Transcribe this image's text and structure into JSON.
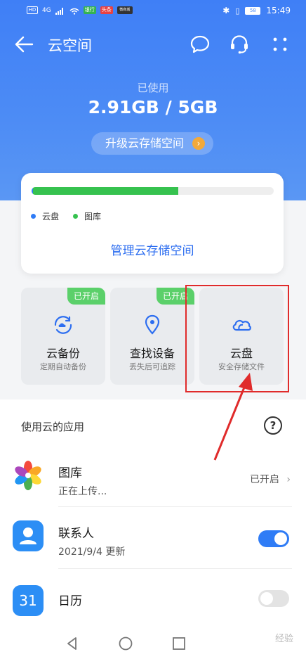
{
  "status_bar": {
    "time": "15:49",
    "battery": "58",
    "left_badges": [
      "HD",
      "4G",
      "银行",
      "头条",
      "微商城"
    ]
  },
  "header": {
    "title": "云空间",
    "back_icon": "back-arrow-icon",
    "actions": [
      "chat-bubble-icon",
      "headset-service-icon",
      "more-dots-icon"
    ]
  },
  "storage": {
    "used_label": "已使用",
    "used_value": "2.91GB / 5GB",
    "upgrade_label": "升级云存储空间",
    "usage_fraction_cloud_drive": 0.005,
    "usage_fraction_gallery": 0.6,
    "legend": [
      {
        "label": "云盘",
        "color": "#2f7cf6"
      },
      {
        "label": "图库",
        "color": "#36c24f"
      }
    ],
    "manage_label": "管理云存储空间"
  },
  "tiles": [
    {
      "name": "云备份",
      "sub": "定期自动备份",
      "badge": "已开启",
      "icon": "cloud-backup-icon"
    },
    {
      "name": "查找设备",
      "sub": "丢失后可追踪",
      "badge": "已开启",
      "icon": "location-pin-icon"
    },
    {
      "name": "云盘",
      "sub": "安全存储文件",
      "badge": "",
      "icon": "cloud-drive-icon"
    }
  ],
  "apps_section": {
    "heading": "使用云的应用",
    "help": "?",
    "items": [
      {
        "name": "图库",
        "sub": "正在上传...",
        "right": "已开启",
        "icon": "gallery-icon"
      },
      {
        "name": "联系人",
        "sub": "2021/9/4 更新",
        "toggle": true,
        "icon": "contacts-icon"
      },
      {
        "name": "日历",
        "sub": "",
        "toggle": false,
        "icon": "calendar-icon",
        "icon_text": "31"
      }
    ]
  },
  "nav": {
    "buttons": [
      "back-triangle-icon",
      "home-circle-icon",
      "recents-square-icon"
    ]
  },
  "watermark": "经验",
  "colors": {
    "accent": "#2d6ef0",
    "hero": "#4d8cf5",
    "toggle_on": "#2f7cf6",
    "badge_green": "#5bd06a",
    "highlight_red": "#e02b2b"
  }
}
